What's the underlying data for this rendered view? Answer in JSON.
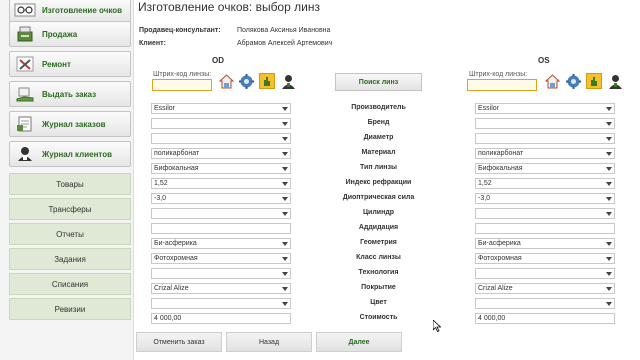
{
  "sidebar": {
    "nav": [
      {
        "label": "Изготовление очков",
        "icon": "glasses-icon"
      },
      {
        "label": "Продажа",
        "icon": "cash-register-icon"
      },
      {
        "label": "Ремонт",
        "icon": "tools-icon"
      },
      {
        "label": "Выдать заказ",
        "icon": "hand-over-icon"
      },
      {
        "label": "Журнал заказов",
        "icon": "order-journal-icon"
      },
      {
        "label": "Журнал клиентов",
        "icon": "client-journal-icon"
      }
    ],
    "sub": [
      "Товары",
      "Трансферы",
      "Отчеты",
      "Задания",
      "Списания",
      "Ревизии"
    ]
  },
  "header": {
    "title": "Изготовление очков: выбор линз",
    "seller_label": "Продавец-консультант:",
    "seller_value": "Полякова Аксинья Ивановна",
    "client_label": "Клиент:",
    "client_value": "Абрамов Алексей Артемович"
  },
  "eyes": {
    "od": {
      "title": "OD",
      "barcode_label": "Штрих-код линзы:",
      "barcode_value": ""
    },
    "os": {
      "title": "OS",
      "barcode_label": "Штрих-код линзы:",
      "barcode_value": ""
    }
  },
  "search_button": "Поиск линз",
  "rows": [
    {
      "label": "Производитель",
      "od": "Essilor",
      "os": "Essilor",
      "select": true
    },
    {
      "label": "Бренд",
      "od": "",
      "os": "",
      "select": true
    },
    {
      "label": "Диаметр",
      "od": "",
      "os": "",
      "select": true
    },
    {
      "label": "Материал",
      "od": "поликарбонат",
      "os": "поликарбонат",
      "select": true
    },
    {
      "label": "Тип линзы",
      "od": "Бифокальная",
      "os": "Бифокальная",
      "select": true
    },
    {
      "label": "Индекс рефракции",
      "od": "1,52",
      "os": "1,52",
      "select": true
    },
    {
      "label": "Диоптрическая сила",
      "od": "-3,0",
      "os": "-3,0",
      "select": true
    },
    {
      "label": "Цилиндр",
      "od": "",
      "os": "",
      "select": true
    },
    {
      "label": "Аддидация",
      "od": "",
      "os": "",
      "select": false
    },
    {
      "label": "Геометрия",
      "od": "Би-асферика",
      "os": "Би-асферика",
      "select": true
    },
    {
      "label": "Класс линзы",
      "od": "Фотохромная",
      "os": "Фотохромная",
      "select": true
    },
    {
      "label": "Технология",
      "od": "",
      "os": "",
      "select": true
    },
    {
      "label": "Покрытие",
      "od": "Crizal Alize",
      "os": "Crizal Alize",
      "select": true
    },
    {
      "label": "Цвет",
      "od": "",
      "os": "",
      "select": true
    },
    {
      "label": "Стоимость",
      "od": "4 000,00",
      "os": "4 000,00",
      "select": false
    }
  ],
  "buttons": {
    "cancel": "Отменить заказ",
    "back": "Назад",
    "next": "Далее"
  },
  "colors": {
    "accent_green": "#2b6a20",
    "sub_nav_bg": "#dfe9d5",
    "barcode_border": "#e3a21b",
    "highlight_tool": "#f5c02a"
  }
}
